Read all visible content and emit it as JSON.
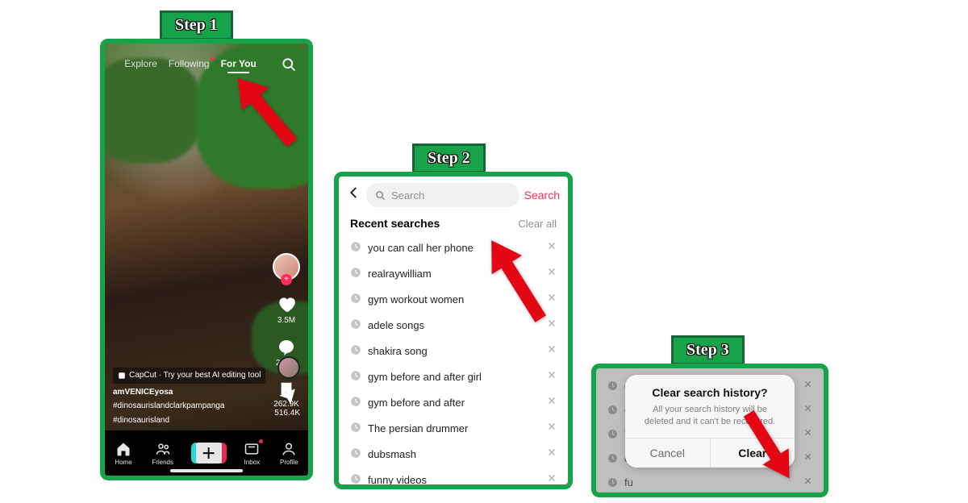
{
  "steps": {
    "s1": "Step 1",
    "s2": "Step 2",
    "s3": "Step 3"
  },
  "step1": {
    "tabs": {
      "explore": "Explore",
      "following": "Following",
      "foryou": "For You"
    },
    "rail": {
      "likes": "3.5M",
      "comments": "20.1K",
      "saves": "262.9K",
      "shares": "516.4K"
    },
    "caption": {
      "capcut": "CapCut · Try your best AI editing tool",
      "user": "amVENICEyosa",
      "hashline1": "#dinosaurislandclarkpampanga",
      "hashline2": "#dinosaurisland"
    },
    "nav": {
      "home": "Home",
      "friends": "Friends",
      "inbox": "Inbox",
      "profile": "Profile"
    }
  },
  "step2": {
    "search_placeholder": "Search",
    "search_btn": "Search",
    "section": "Recent searches",
    "clear_all": "Clear all",
    "items": [
      "you can call her phone",
      "realraywilliam",
      "gym workout women",
      "adele songs",
      "shakira song",
      "gym before and after girl",
      "gym before and after",
      "The persian drummer",
      "dubsmash",
      "funny videos"
    ]
  },
  "step3": {
    "dim_items": [
      "gy",
      "gy",
      "Th",
      "du",
      "fu"
    ],
    "dlg_title": "Clear search history?",
    "dlg_msg": "All your search history will be deleted and it can't be recovered.",
    "cancel": "Cancel",
    "clear": "Clear"
  }
}
